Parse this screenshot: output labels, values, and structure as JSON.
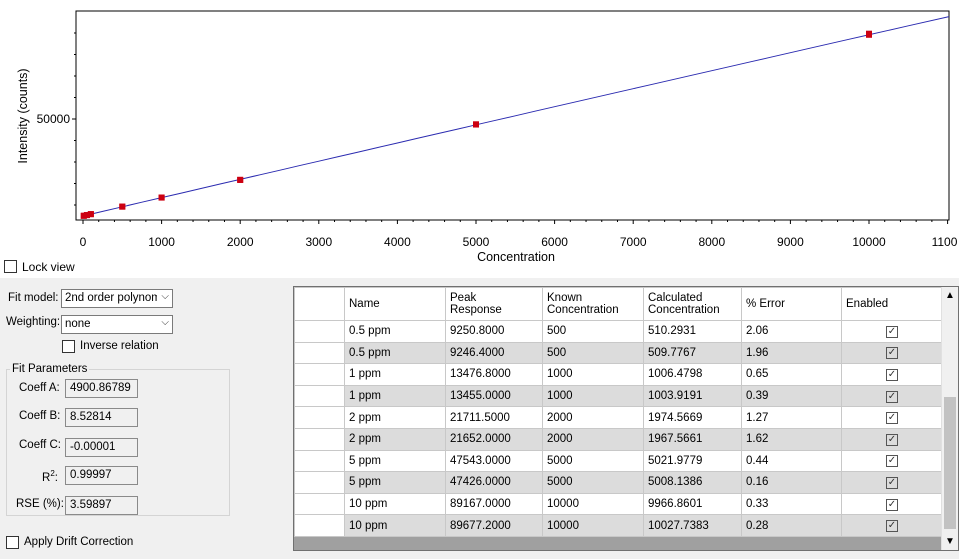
{
  "chart": {
    "y_axis_label": "Intensity (counts)",
    "x_axis_label": "Concentration",
    "lock_view_label": "Lock view"
  },
  "chart_data": {
    "type": "scatter",
    "xlabel": "Concentration",
    "ylabel": "Intensity (counts)",
    "xlim": [
      -50,
      11000
    ],
    "ylim": [
      0,
      95000
    ],
    "x_ticks": [
      0,
      1000,
      2000,
      3000,
      4000,
      5000,
      6000,
      7000,
      8000,
      9000,
      10000
    ],
    "x_tick_labels": [
      "0",
      "1000",
      "2000",
      "3000",
      "4000",
      "5000",
      "6000",
      "7000",
      "8000",
      "9000",
      "10000",
      "1100"
    ],
    "y_ticks": [
      50000
    ],
    "y_tick_labels": [
      "50000"
    ],
    "grid": false,
    "marker_color": "#cc0011",
    "fit_line_color": "#2b2bb0",
    "fit": {
      "A": 4900.86789,
      "B": 8.52814,
      "C": -1e-05
    },
    "points": [
      {
        "x": 10,
        "y": 4990
      },
      {
        "x": 10,
        "y": 4985
      },
      {
        "x": 50,
        "y": 5320
      },
      {
        "x": 50,
        "y": 5310
      },
      {
        "x": 100,
        "y": 5750
      },
      {
        "x": 100,
        "y": 5745
      },
      {
        "x": 500,
        "y": 9250.8
      },
      {
        "x": 500,
        "y": 9246.4
      },
      {
        "x": 1000,
        "y": 13476.8
      },
      {
        "x": 1000,
        "y": 13455.0
      },
      {
        "x": 2000,
        "y": 21711.5
      },
      {
        "x": 2000,
        "y": 21652.0
      },
      {
        "x": 5000,
        "y": 47543.0
      },
      {
        "x": 5000,
        "y": 47426.0
      },
      {
        "x": 10000,
        "y": 89167.0
      },
      {
        "x": 10000,
        "y": 89677.2
      }
    ]
  },
  "fit_settings": {
    "fit_model_label": "Fit model:",
    "fit_model_value": "2nd order polynomi",
    "weighting_label": "Weighting:",
    "weighting_value": "none",
    "inverse_relation_label": "Inverse relation",
    "fit_parameters_title": "Fit Parameters",
    "coeff_a_label": "Coeff A:",
    "coeff_a_value": "4900.86789",
    "coeff_b_label": "Coeff B:",
    "coeff_b_value": "8.52814",
    "coeff_c_label": "Coeff C:",
    "coeff_c_value": "-0.00001",
    "r2_label": "R",
    "r2_sup": "2",
    "r2_colon": ":",
    "r2_value": "0.99997",
    "rse_label": "RSE (%):",
    "rse_value": "3.59897",
    "drift_correction_label": "Apply Drift Correction"
  },
  "table": {
    "columns": [
      "",
      "Name",
      "Peak\nResponse",
      "Known\nConcentration",
      "Calculated\nConcentration",
      "% Error",
      "Enabled"
    ],
    "rows": [
      {
        "name": "0.5 ppm",
        "peak": "9250.8000",
        "known": "500",
        "calc": "510.2931",
        "err": "2.06",
        "enabled": true
      },
      {
        "name": "0.5 ppm",
        "peak": "9246.4000",
        "known": "500",
        "calc": "509.7767",
        "err": "1.96",
        "enabled": true
      },
      {
        "name": "1 ppm",
        "peak": "13476.8000",
        "known": "1000",
        "calc": "1006.4798",
        "err": "0.65",
        "enabled": true
      },
      {
        "name": "1 ppm",
        "peak": "13455.0000",
        "known": "1000",
        "calc": "1003.9191",
        "err": "0.39",
        "enabled": true
      },
      {
        "name": "2 ppm",
        "peak": "21711.5000",
        "known": "2000",
        "calc": "1974.5669",
        "err": "1.27",
        "enabled": true
      },
      {
        "name": "2 ppm",
        "peak": "21652.0000",
        "known": "2000",
        "calc": "1967.5661",
        "err": "1.62",
        "enabled": true
      },
      {
        "name": "5 ppm",
        "peak": "47543.0000",
        "known": "5000",
        "calc": "5021.9779",
        "err": "0.44",
        "enabled": true
      },
      {
        "name": "5 ppm",
        "peak": "47426.0000",
        "known": "5000",
        "calc": "5008.1386",
        "err": "0.16",
        "enabled": true
      },
      {
        "name": "10 ppm",
        "peak": "89167.0000",
        "known": "10000",
        "calc": "9966.8601",
        "err": "0.33",
        "enabled": true
      },
      {
        "name": "10 ppm",
        "peak": "89677.2000",
        "known": "10000",
        "calc": "10027.7383",
        "err": "0.28",
        "enabled": true
      }
    ],
    "check_glyph": "✓",
    "scroll_up_glyph": "▲",
    "scroll_down_glyph": "▼"
  },
  "icons": {
    "dropdown": "chevron-down-icon",
    "check": "checkmark-icon"
  }
}
